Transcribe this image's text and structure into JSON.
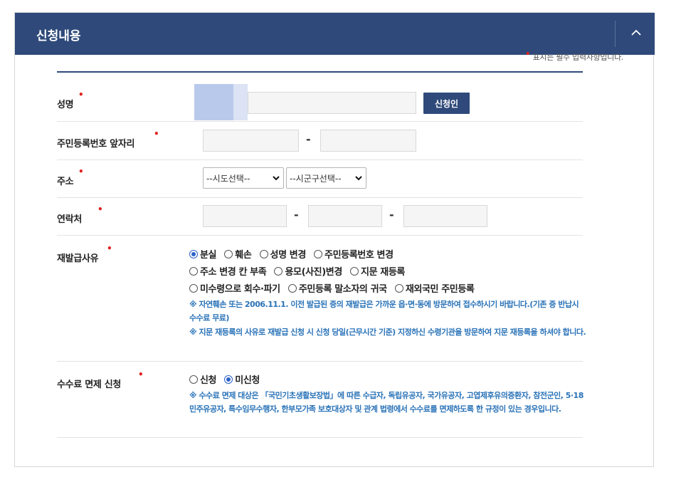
{
  "header": {
    "title": "신청내용"
  },
  "required_note": "표시는 필수 입력사항입니다.",
  "fields": {
    "name": {
      "label": "성명",
      "value": "",
      "button": "신청인"
    },
    "rrn": {
      "label": "주민등록번호 앞자리",
      "dash": "-"
    },
    "address": {
      "label": "주소",
      "sido": "--시도선택--",
      "sigungu": "--시군구선택--"
    },
    "phone": {
      "label": "연락처",
      "dash1": "-",
      "dash2": "-"
    },
    "reason": {
      "label": "재발급사유",
      "options": [
        "분실",
        "훼손",
        "성명 변경",
        "주민등록번호 변경",
        "주소 변경 칸 부족",
        "용모(사진)변경",
        "지문 재등록",
        "미수령으로 회수·파기",
        "주민등록 말소자의 귀국",
        "재외국민 주민등록"
      ],
      "selected": "분실",
      "notes": [
        "※ 자연훼손 또는 2006.11.1. 이전 발급된 증의 재발급은 가까운 읍·면·동에 방문하여 접수하시기 바랍니다.(기존 증 반납시 수수료 무료)",
        "※ 지문 재등록의 사유로 재발급 신청 시 신청 당일(근무시간 기준) 지정하신 수령기관을 방문하여 지문 재등록을 하셔야 합니다."
      ]
    },
    "fee": {
      "label": "수수료 면제 신청",
      "options": [
        "신청",
        "미신청"
      ],
      "selected": "미신청",
      "note": "※ 수수료 면제 대상은 「국민기초생활보장법」에 따른 수급자, 독립유공자, 국가유공자, 고엽제후유의증환자, 참전군인, 5·18민주유공자, 특수임무수행자, 한부모가족 보호대상자 및 관계 법령에서 수수료를 면제하도록 한 규정이 있는 경우입니다."
    }
  },
  "colors": {
    "header": "#2f4a7a",
    "required": "#e0201f",
    "note": "#2a73b8",
    "radio_selected": "#2c62c8"
  },
  "icons": {
    "collapse": "chevron-up-icon",
    "select_arrow": "chevron-down-icon"
  }
}
